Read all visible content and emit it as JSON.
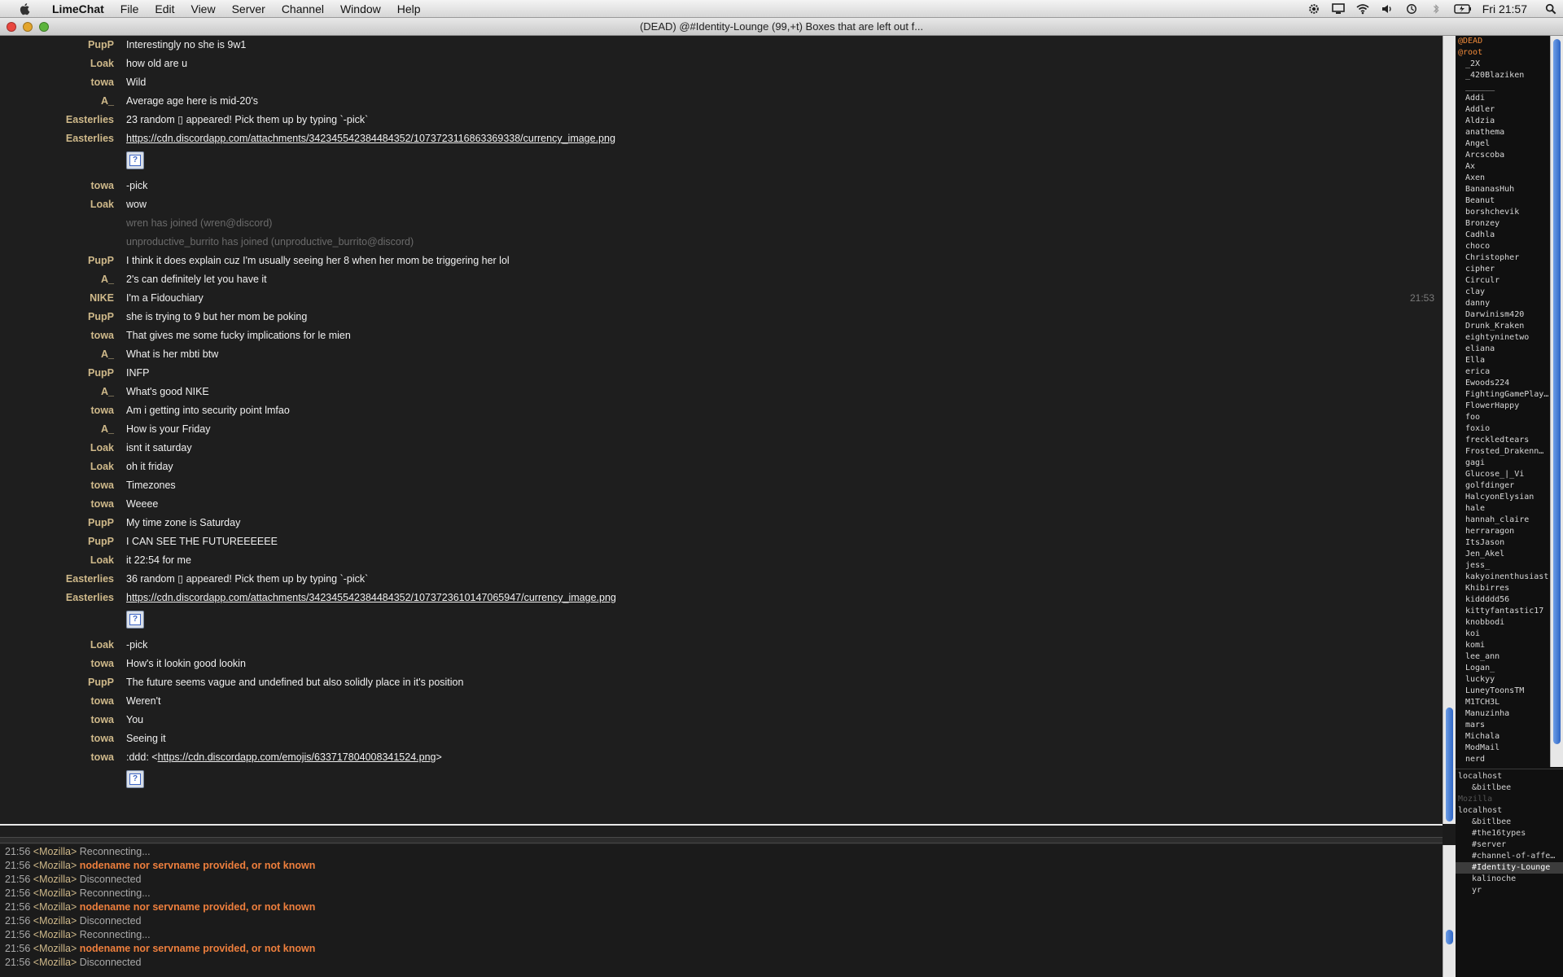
{
  "menubar": {
    "app": "LimeChat",
    "menus": [
      "File",
      "Edit",
      "View",
      "Server",
      "Channel",
      "Window",
      "Help"
    ],
    "clock": "Fri 21:57",
    "tray_icons": [
      "gear-icon",
      "monitor-icon",
      "wifi-icon",
      "volume-icon",
      "time-machine-icon",
      "bluetooth-icon",
      "battery-icon",
      "spotlight-icon"
    ]
  },
  "window": {
    "title": "(DEAD) @#Identity-Lounge (99,+t) Boxes that are left out f..."
  },
  "chat": {
    "messages": [
      {
        "nick": "PupP",
        "text": "Interestingly no she is 9w1"
      },
      {
        "nick": "Loak",
        "text": "how old are u"
      },
      {
        "nick": "towa",
        "text": "Wild"
      },
      {
        "nick": "A_",
        "text": "Average age here is mid-20's"
      },
      {
        "nick": "Easterlies",
        "text": "23 random ▯ appeared! Pick them up by typing `-pick`"
      },
      {
        "nick": "Easterlies",
        "link": "https://cdn.discordapp.com/attachments/342345542384484352/1073723116863369338/currency_image.png"
      },
      {
        "nick": "towa",
        "text": "-pick"
      },
      {
        "nick": "Loak",
        "text": "wow"
      },
      {
        "join": "wren has joined (wren@discord)"
      },
      {
        "join": "unproductive_burrito has joined (unproductive_burrito@discord)"
      },
      {
        "nick": "PupP",
        "text": "I think it does explain cuz I'm usually seeing her 8 when her mom be triggering her lol"
      },
      {
        "nick": "A_",
        "text": "2's can definitely let you have it"
      },
      {
        "nick": "NIKE",
        "text": "I'm a Fidouchiary",
        "stamp": "21:53"
      },
      {
        "nick": "PupP",
        "text": "she is trying to 9 but her mom be poking"
      },
      {
        "nick": "towa",
        "text": "That gives me some fucky implications for le mien"
      },
      {
        "nick": "A_",
        "text": "What is her mbti btw"
      },
      {
        "nick": "PupP",
        "text": "INFP"
      },
      {
        "nick": "A_",
        "text": "What's good NIKE"
      },
      {
        "nick": "towa",
        "text": "Am i getting into security point lmfao"
      },
      {
        "nick": "A_",
        "text": "How is your Friday"
      },
      {
        "nick": "Loak",
        "text": "isnt it saturday"
      },
      {
        "nick": "Loak",
        "text": "oh it friday"
      },
      {
        "nick": "towa",
        "text": "Timezones"
      },
      {
        "nick": "towa",
        "text": "Weeee"
      },
      {
        "nick": "PupP",
        "text": "My time zone is Saturday"
      },
      {
        "nick": "PupP",
        "text": "I CAN SEE THE FUTUREEEEEE"
      },
      {
        "nick": "Loak",
        "text": "it 22:54 for me"
      },
      {
        "nick": "Easterlies",
        "text": "36 random ▯ appeared! Pick them up by typing `-pick`"
      },
      {
        "nick": "Easterlies",
        "link": "https://cdn.discordapp.com/attachments/342345542384484352/1073723610147065947/currency_image.png"
      },
      {
        "nick": "Loak",
        "text": "-pick"
      },
      {
        "nick": "towa",
        "text": "How's it lookin good lookin"
      },
      {
        "nick": "PupP",
        "text": "The future seems vague and undefined but also solidly place in it's position"
      },
      {
        "nick": "towa",
        "text": "Weren't"
      },
      {
        "nick": "towa",
        "text": "You"
      },
      {
        "nick": "towa",
        "text": "Seeing it"
      },
      {
        "nick": "towa",
        "text": ":ddd: <",
        "link": "https://cdn.discordapp.com/emojis/633717804008341524.png",
        "suffix": ">"
      }
    ],
    "image_placeholder_glyph": "?"
  },
  "console": {
    "lines": [
      {
        "time": "21:56",
        "who": "<Mozilla>",
        "text": "Reconnecting...",
        "error": false
      },
      {
        "time": "21:56",
        "who": "<Mozilla>",
        "text": "nodename nor servname provided, or not known",
        "error": true
      },
      {
        "time": "21:56",
        "who": "<Mozilla>",
        "text": "Disconnected",
        "error": false
      },
      {
        "time": "21:56",
        "who": "<Mozilla>",
        "text": "Reconnecting...",
        "error": false
      },
      {
        "time": "21:56",
        "who": "<Mozilla>",
        "text": "nodename nor servname provided, or not known",
        "error": true
      },
      {
        "time": "21:56",
        "who": "<Mozilla>",
        "text": "Disconnected",
        "error": false
      },
      {
        "time": "21:56",
        "who": "<Mozilla>",
        "text": "Reconnecting...",
        "error": false
      },
      {
        "time": "21:56",
        "who": "<Mozilla>",
        "text": "nodename nor servname provided, or not known",
        "error": true
      },
      {
        "time": "21:56",
        "who": "<Mozilla>",
        "text": "Disconnected",
        "error": false
      }
    ]
  },
  "members": {
    "ops": [
      "@DEAD",
      "@root"
    ],
    "users": [
      "_2X",
      "_420Blaziken",
      "______",
      "Addi",
      "Addler",
      "Aldzia",
      "anathema",
      "Angel",
      "Arcscoba",
      "Ax",
      "Axen",
      "BananasHuh",
      "Beanut",
      "borshchevik",
      "Bronzey",
      "Cadhla",
      "choco",
      "Christopher",
      "cipher",
      "Circulr",
      "clay",
      "danny",
      "Darwinism420",
      "Drunk_Kraken",
      "eightyninetwo",
      "eliana",
      "Ella",
      "erica",
      "Ewoods224",
      "FightingGamePlay…",
      "FlowerHappy",
      "foo",
      "foxio",
      "freckledtears",
      "Frosted_Drakenn…",
      "gagi",
      "Glucose_|_Vi",
      "golfdinger",
      "HalcyonElysian",
      "hale",
      "hannah_claire",
      "herraragon",
      "ItsJason",
      "Jen_Akel",
      "jess_",
      "kakyoinenthusiast",
      "Khibirres",
      "kiddddd56",
      "kittyfantastic17",
      "knobbodi",
      "koi",
      "komi",
      "lee_ann",
      "Logan_",
      "luckyy",
      "LuneyToonsTM",
      "M1TCH3L",
      "Manuzinha",
      "mars",
      "Michala",
      "ModMail",
      "nerd"
    ]
  },
  "servers": [
    {
      "label": "localhost",
      "level": 0,
      "dim": false,
      "selected": false
    },
    {
      "label": "&bitlbee",
      "level": 1,
      "dim": false,
      "selected": false
    },
    {
      "label": "Mozilla",
      "level": 0,
      "dim": true,
      "selected": false
    },
    {
      "label": "localhost",
      "level": 0,
      "dim": false,
      "selected": false
    },
    {
      "label": "&bitlbee",
      "level": 1,
      "dim": false,
      "selected": false
    },
    {
      "label": "#the16types",
      "level": 1,
      "dim": false,
      "selected": false
    },
    {
      "label": "#server",
      "level": 1,
      "dim": false,
      "selected": false
    },
    {
      "label": "#channel-of-affe…",
      "level": 1,
      "dim": false,
      "selected": false
    },
    {
      "label": "#Identity-Lounge",
      "level": 1,
      "dim": false,
      "selected": true
    },
    {
      "label": "kalinoche",
      "level": 1,
      "dim": false,
      "selected": false
    },
    {
      "label": "yr",
      "level": 1,
      "dim": false,
      "selected": false
    }
  ],
  "colors": {
    "nick": "#cfb98a",
    "error": "#ee7f3d",
    "op": "#f08a3a",
    "scroll_thumb": "#2f66c6"
  }
}
